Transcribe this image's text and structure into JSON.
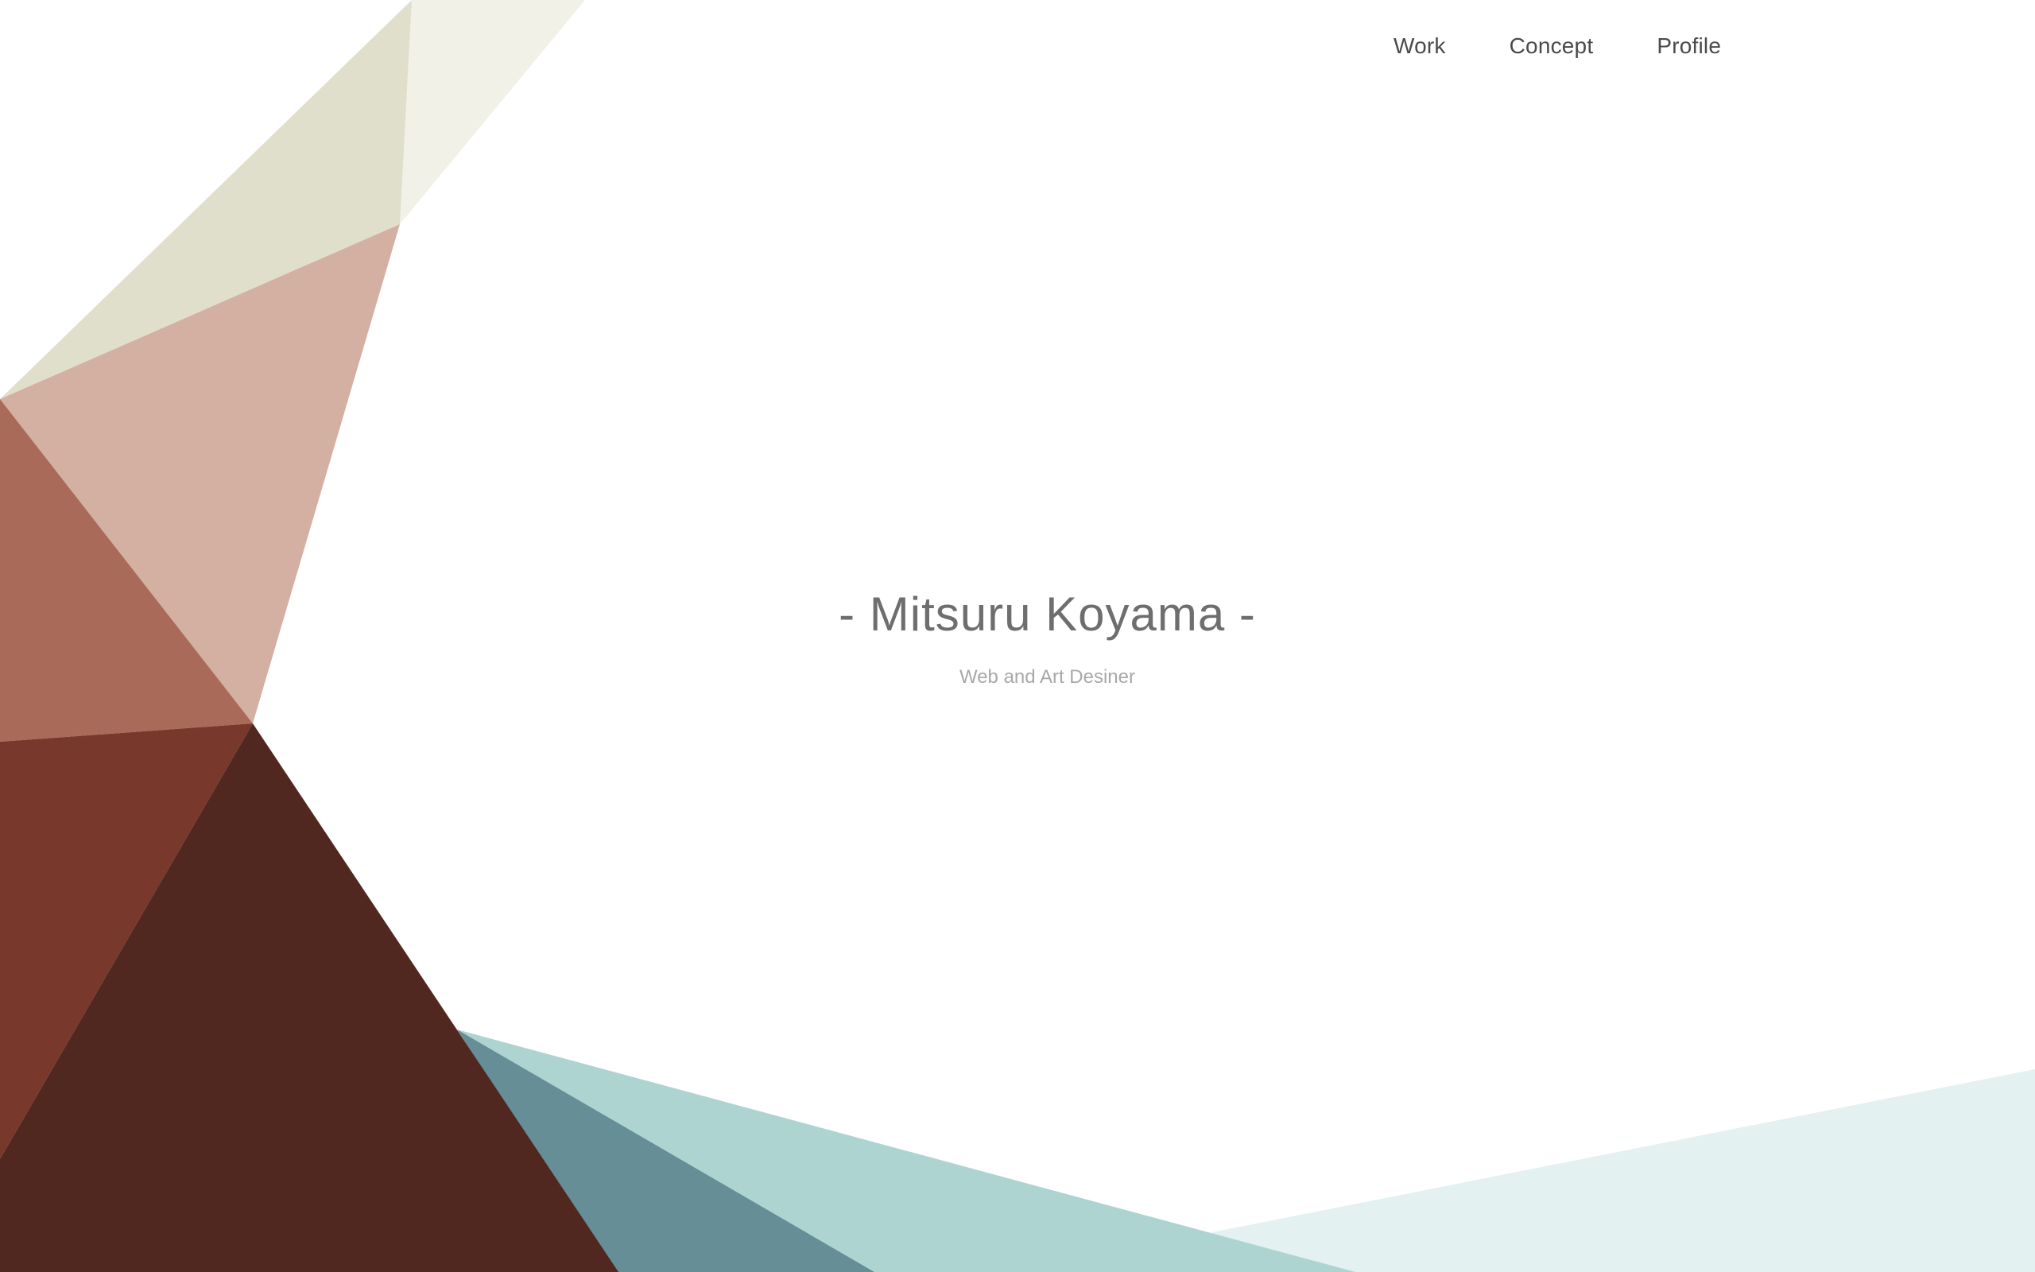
{
  "nav": {
    "items": [
      {
        "label": "Work"
      },
      {
        "label": "Concept"
      },
      {
        "label": "Profile"
      }
    ]
  },
  "hero": {
    "title": "- Mitsuru Koyama -",
    "subtitle": "Web and Art Desiner"
  },
  "colors": {
    "background": "#ffffff",
    "nav_text": "#4a4a4a",
    "title_text": "#6e6e6e",
    "subtitle_text": "#a8a8a8",
    "facet_pale_cream": "#f1f1e8",
    "facet_khaki": "#e0dfcc",
    "facet_blush": "#d4b0a2",
    "facet_terracotta": "#a96a59",
    "facet_rust": "#78382c",
    "facet_dark_brown": "#50281f",
    "facet_slate_teal": "#658e96",
    "facet_mint": "#aed4d1",
    "facet_pale_mint": "#e3f1f0"
  }
}
